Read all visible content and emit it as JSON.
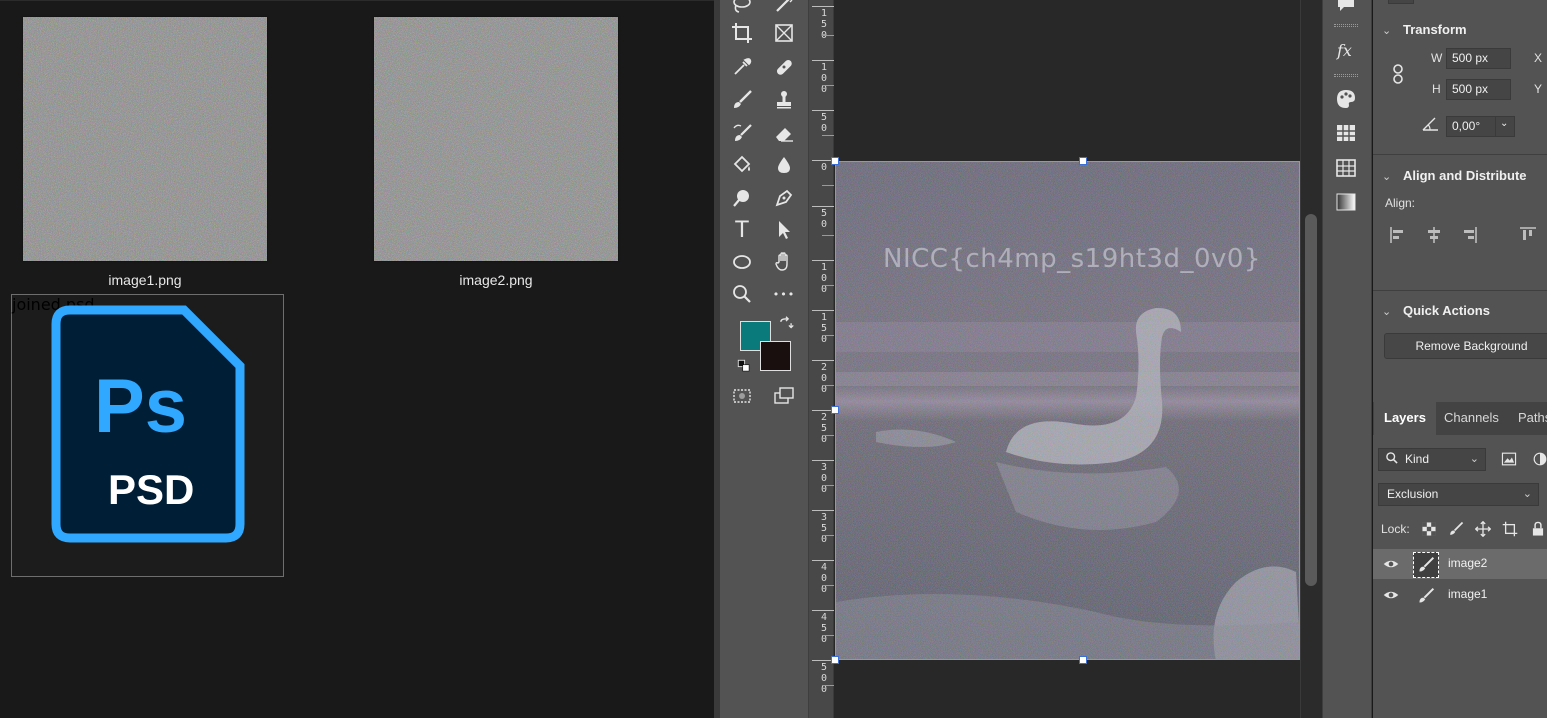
{
  "explorer": {
    "files": [
      {
        "name": "image1.png",
        "type": "noise-image"
      },
      {
        "name": "image2.png",
        "type": "noise-image"
      },
      {
        "name": "joined.psd",
        "type": "psd-file",
        "icon_text_main": "Ps",
        "icon_text_sub": "PSD"
      }
    ]
  },
  "toolbar": {
    "tools": [
      "lasso-icon",
      "object-selection-icon",
      "crop-icon",
      "frame-icon",
      "eyedropper-icon",
      "healing-brush-icon",
      "brush-icon",
      "clone-stamp-icon",
      "history-brush-icon",
      "eraser-icon",
      "paint-bucket-icon",
      "blur-icon",
      "dodge-icon",
      "pen-icon",
      "type-icon",
      "path-selection-icon",
      "ellipse-icon",
      "hand-icon",
      "zoom-icon",
      "more-tools-icon"
    ],
    "type_tool_glyph": "T",
    "more_glyph": "•••",
    "foreground_color": "#0a7a7a",
    "background_color": "#1a0f0f"
  },
  "ruler": {
    "labels": [
      "1 5 0",
      "1 0 0",
      "5 0",
      "0",
      "5 0",
      "1 0 0",
      "1 5 0",
      "2 0 0",
      "2 5 0",
      "3 0 0",
      "3 5 0",
      "4 0 0",
      "4 5 0",
      "5 0 0"
    ]
  },
  "canvas": {
    "watermark_text": "NICC{ch4mp_s19ht3d_0v0}"
  },
  "properties": {
    "transform": {
      "title": "Transform",
      "w_label": "W",
      "w_value": "500 px",
      "h_label": "H",
      "h_value": "500 px",
      "x_label": "X",
      "y_label": "Y",
      "angle_value": "0,00°"
    },
    "align": {
      "title": "Align and Distribute",
      "align_label": "Align:"
    },
    "quick_actions": {
      "title": "Quick Actions",
      "remove_bg_label": "Remove Background"
    }
  },
  "layers": {
    "tabs": [
      "Layers",
      "Channels",
      "Paths"
    ],
    "filter_label": "Kind",
    "blend_mode": "Exclusion",
    "lock_label": "Lock:",
    "items": [
      {
        "name": "image2",
        "selected": true
      },
      {
        "name": "image1",
        "selected": false
      }
    ]
  }
}
